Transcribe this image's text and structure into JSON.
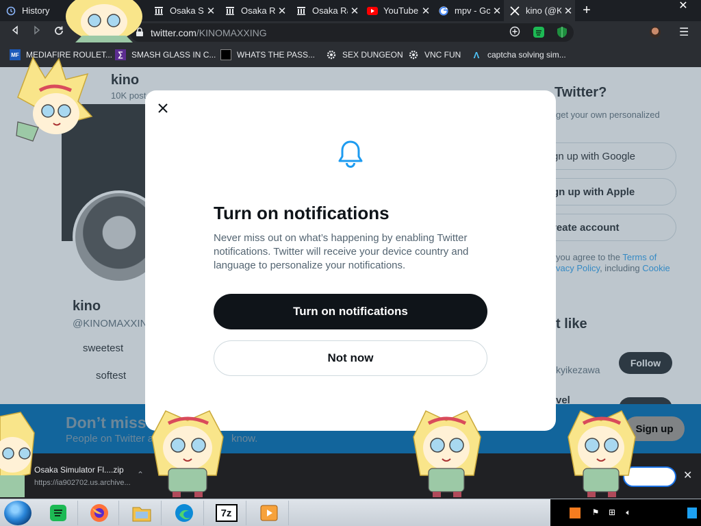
{
  "browser": {
    "tabs": [
      {
        "label": "History",
        "icon": "history-icon",
        "active": false
      },
      {
        "label": "Osaka Si",
        "icon": "archive-icon",
        "active": false
      },
      {
        "label": "Osaka Ra",
        "icon": "archive-icon",
        "active": false
      },
      {
        "label": "Osaka Ra",
        "icon": "archive-icon",
        "active": false
      },
      {
        "label": "YouTube",
        "icon": "youtube-icon",
        "active": false
      },
      {
        "label": "mpv - Gc",
        "icon": "google-icon",
        "active": false
      },
      {
        "label": "kino (@K",
        "icon": "x-logo-icon",
        "active": true
      }
    ],
    "new_tab_symbol": "+",
    "window_close_symbol": "✕",
    "url_host": "twitter.com",
    "url_path": "/KINOMAXXING",
    "bookmarks": [
      {
        "label": "MEDIAFIRE ROULET...",
        "icon": "mediafire-icon",
        "icon_text": "MF"
      },
      {
        "label": "SMASH GLASS IN C...",
        "icon": "visual-studio-icon",
        "icon_text": "∑"
      },
      {
        "label": "WHATS THE PASS...",
        "icon": "archive-icon",
        "icon_text": ""
      },
      {
        "label": "SEX DUNGEON",
        "icon": "gear-icon",
        "icon_text": ""
      },
      {
        "label": "VNC FUN",
        "icon": "gear-icon",
        "icon_text": ""
      },
      {
        "label": "captcha solving sim...",
        "icon": "arrow-logo-icon",
        "icon_text": "Λ"
      }
    ]
  },
  "page": {
    "profile_name_top": "kino",
    "posts_count": "10K post",
    "profile_name": "kino",
    "profile_handle": "@KINOMAXXIN",
    "bio_line1": "sweetest",
    "bio_line2": "softest",
    "side_heading": "New to Twitter?",
    "side_heading_visible": "Twitter?",
    "side_sub": "get your own personalized",
    "signup_google": "gn up with Google",
    "signup_apple": "gn up with Apple",
    "create_account": "reate account",
    "terms_prefix": "you agree to the",
    "terms_link": "Terms of",
    "privacy_link": "vacy Policy",
    "including": ", including",
    "cookie_link": "Cookie",
    "might_like": "t like",
    "suggest_handle": "kyikezawa",
    "follow_label": "Follow",
    "suggest2": "vel"
  },
  "modal": {
    "title": "Turn on notifications",
    "description": "Never miss out on what’s happening by enabling Twitter notifications. Twitter will receive your device country and language to personalize your notifications.",
    "primary_button": "Turn on notifications",
    "secondary_button": "Not now",
    "close_symbol": "✕"
  },
  "bottom_bar": {
    "title": "Don’t miss",
    "subtitle_start": "People on Twitter a",
    "subtitle_end": "know.",
    "signup_button": "Sign up"
  },
  "downloads": {
    "file_name": "Osaka Simulator Fl....zip",
    "file_url": "https://ia902702.us.archive...",
    "chevron": "⌃",
    "close_symbol": "✕"
  },
  "taskbar": {
    "apps": [
      "spotify-icon",
      "firefox-icon",
      "file-explorer-icon",
      "edge-icon",
      "7zip-icon",
      "media-player-icon"
    ],
    "sevenzip_label": "7z"
  },
  "colors": {
    "twitter_blue": "#1d9bf0",
    "modal_text": "#0f1419",
    "muted_text": "#536471",
    "link_blue": "#1d9bf0"
  }
}
